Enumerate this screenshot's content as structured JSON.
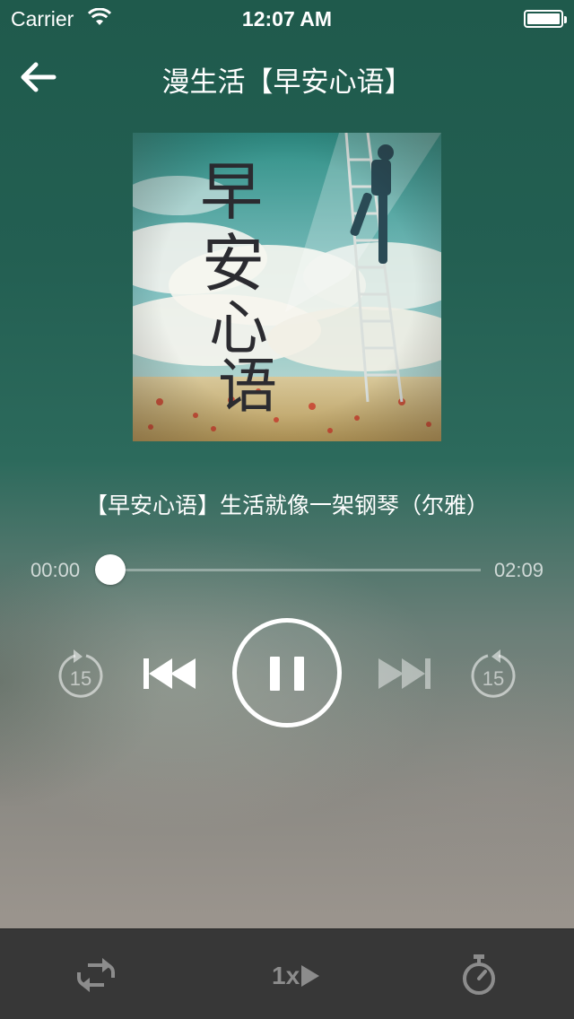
{
  "status_bar": {
    "carrier": "Carrier",
    "time": "12:07 AM"
  },
  "nav": {
    "title": "漫生活【早安心语】"
  },
  "album": {
    "cover_text": "早安心语"
  },
  "player": {
    "track_title": "【早安心语】生活就像一架钢琴（尔雅）",
    "current_time": "00:00",
    "total_time": "02:09",
    "progress": 0.0,
    "skip_back_seconds": "15",
    "skip_forward_seconds": "15",
    "state": "playing"
  },
  "bottom_bar": {
    "speed_label": "1x"
  },
  "icons": [
    "wifi-icon",
    "battery-icon",
    "back-arrow-icon",
    "rewind-15-icon",
    "previous-track-icon",
    "pause-icon",
    "next-track-icon",
    "forward-15-icon",
    "repeat-icon",
    "play-speed-icon",
    "timer-icon"
  ],
  "colors": {
    "accent": "#ffffff",
    "bottom_bar": "#373737",
    "disabled_icon": "#8c8c8c"
  }
}
